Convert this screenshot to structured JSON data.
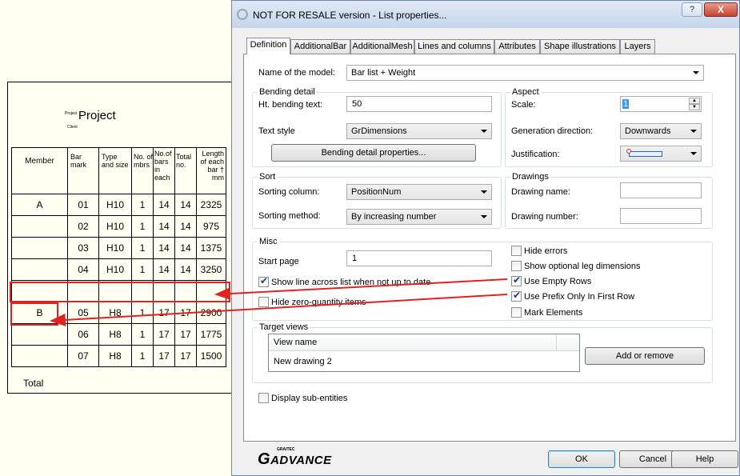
{
  "drawing": {
    "project_small": "Project",
    "project_title": "Project",
    "client_small": "Client",
    "headers": [
      "Member",
      "Bar mark",
      "Type and size",
      "No. of mbrs",
      "No.of bars in each",
      "Total no.",
      "Length of each bar † mm"
    ],
    "rows": [
      [
        "A",
        "01",
        "H10",
        "1",
        "14",
        "14",
        "2325"
      ],
      [
        "",
        "02",
        "H10",
        "1",
        "14",
        "14",
        "975"
      ],
      [
        "",
        "03",
        "H10",
        "1",
        "14",
        "14",
        "1375"
      ],
      [
        "",
        "04",
        "H10",
        "1",
        "14",
        "14",
        "3250"
      ],
      [
        "",
        "",
        "",
        "",
        "",
        "",
        ""
      ],
      [
        "B",
        "05",
        "H8",
        "1",
        "17",
        "17",
        "2900"
      ],
      [
        "",
        "06",
        "H8",
        "1",
        "17",
        "17",
        "1775"
      ],
      [
        "",
        "07",
        "H8",
        "1",
        "17",
        "17",
        "1500"
      ]
    ],
    "total_label": "Total"
  },
  "dialog": {
    "title": "NOT FOR RESALE version - List properties...",
    "help_glyph": "?",
    "close_glyph": "X",
    "tabs": [
      "Definition",
      "AdditionalBar",
      "AdditionalMesh",
      "Lines and columns",
      "Attributes",
      "Shape illustrations",
      "Layers"
    ],
    "active_tab": "Definition",
    "model_label": "Name of the model:",
    "model_value": "Bar list + Weight",
    "bending": {
      "title": "Bending detail",
      "ht_label": "Ht. bending text:",
      "ht_value": "50",
      "style_label": "Text style",
      "style_value": "GrDimensions",
      "props_button": "Bending detail properties..."
    },
    "aspect": {
      "title": "Aspect",
      "scale_label": "Scale:",
      "scale_value": "1",
      "direction_label": "Generation direction:",
      "direction_value": "Downwards",
      "justification_label": "Justification:"
    },
    "sort": {
      "title": "Sort",
      "column_label": "Sorting column:",
      "column_value": "PositionNum",
      "method_label": "Sorting method:",
      "method_value": "By increasing number"
    },
    "drawings": {
      "title": "Drawings",
      "name_label": "Drawing name:",
      "number_label": "Drawing number:"
    },
    "misc": {
      "title": "Misc",
      "start_label": "Start page",
      "start_value": "1",
      "show_line": "Show line across list when not up to date",
      "hide_zero": "Hide zero-quantity items",
      "hide_errors": "Hide errors",
      "show_optional": "Show optional leg dimensions",
      "use_empty_rows": "Use Empty Rows",
      "use_prefix": "Use Prefix Only In First Row",
      "mark_elements": "Mark Elements"
    },
    "checks": {
      "show_line": true,
      "hide_zero": false,
      "hide_errors": false,
      "show_optional": false,
      "use_empty_rows": true,
      "use_prefix": true,
      "mark_elements": false,
      "display_sub": false
    },
    "target": {
      "title": "Target views",
      "column_header": "View name",
      "rows": [
        "New drawing 2"
      ],
      "add_button": "Add or remove"
    },
    "display_sub": "Display sub-entities",
    "logo_small": "GRAITEC",
    "logo_g": "G",
    "logo_text": "ADVANCE",
    "ok": "OK",
    "cancel": "Cancel",
    "help": "Help"
  },
  "colors": {
    "annotation": "#e22222",
    "drawing_bg": "#fffff2",
    "dialog_bg": "#f0f0f0"
  }
}
